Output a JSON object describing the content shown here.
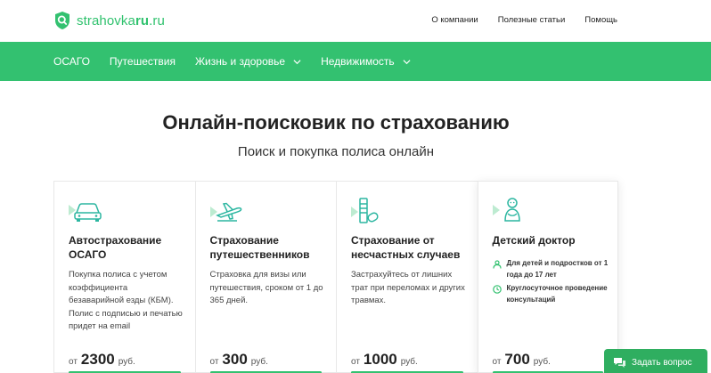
{
  "logo": {
    "text_main": "strahovka",
    "text_bold": "ru",
    "text_suffix": ".ru"
  },
  "topnav": [
    {
      "label": "О компании"
    },
    {
      "label": "Полезные статьи"
    },
    {
      "label": "Помощь"
    }
  ],
  "mainnav": [
    {
      "label": "ОСАГО",
      "dropdown": false
    },
    {
      "label": "Путешествия",
      "dropdown": false
    },
    {
      "label": "Жизнь и здоровье",
      "dropdown": true
    },
    {
      "label": "Недвижимость",
      "dropdown": true
    }
  ],
  "hero": {
    "title": "Онлайн-поисковик по страхованию",
    "subtitle": "Поиск и покупка полиса онлайн"
  },
  "cards": [
    {
      "icon": "car-icon",
      "title": "Автострахование ОСАГО",
      "desc": "Покупка полиса с учетом коэффициента безаварийной езды (КБМ). Полис с подписью и печатью придет на email",
      "price_prefix": "от",
      "price": "2300",
      "price_unit": "руб."
    },
    {
      "icon": "airplane-icon",
      "title": "Страхование путешественников",
      "desc": "Страховка для визы или путешествия, сроком от 1 до 365 дней.",
      "price_prefix": "от",
      "price": "300",
      "price_unit": "руб."
    },
    {
      "icon": "bandage-icon",
      "title": "Страхование от несчастных случаев",
      "desc": "Застрахуйтесь от лишних трат при переломах и других травмах.",
      "price_prefix": "от",
      "price": "1000",
      "price_unit": "руб."
    },
    {
      "icon": "baby-icon",
      "title": "Детский доктор",
      "features": [
        {
          "icon": "person-icon",
          "text": "Для детей и подростков от 1 года до 17 лет"
        },
        {
          "icon": "clock-icon",
          "text": "Круглосуточное проведение консультаций"
        }
      ],
      "price_prefix": "от",
      "price": "700",
      "price_unit": "руб."
    }
  ],
  "chat": {
    "label": "Задать вопрос",
    "icon": "chat-icon"
  },
  "colors": {
    "brand_green": "#33c170",
    "icon_teal": "#2bb6a0",
    "chat_green": "#2fae60"
  }
}
